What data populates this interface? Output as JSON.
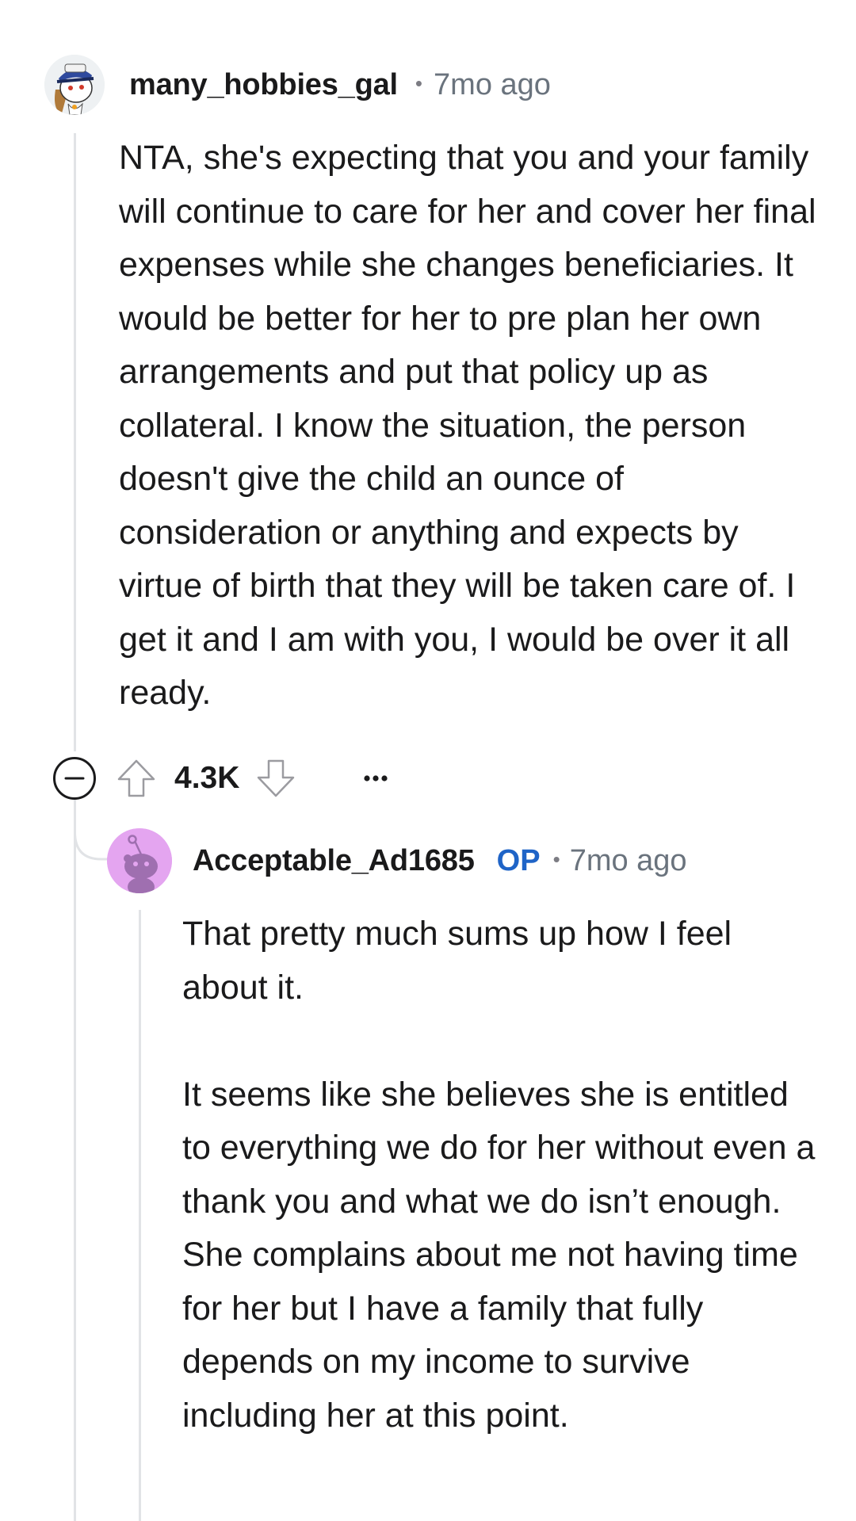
{
  "comments": [
    {
      "username": "many_hobbies_gal",
      "time": "7mo ago",
      "avatar_icon": "snoo-avatar-sailor",
      "text": "NTA, she's expecting that you and your family will continue to care for her and cover her final expenses while she changes beneficiaries. It would be better for her to pre plan her own arrangements and put that policy up as collateral. I know the situation, the person doesn't give the child an ounce of consideration or anything and expects by virtue of birth that they will be taken care of. I get it and I am with you, I would be over it all ready.",
      "actions": {
        "collapse_icon": "collapse-minus-icon",
        "upvote_icon": "upvote-arrow-icon",
        "vote_count": "4.3K",
        "downvote_icon": "downvote-arrow-icon",
        "more_icon": "more-options-icon"
      }
    },
    {
      "username": "Acceptable_Ad1685",
      "op_badge": "OP",
      "time": "7mo ago",
      "avatar_icon": "snoo-avatar-default",
      "paragraphs": [
        "That pretty much sums up how I feel about it.",
        "It seems like she believes she is entitled to everything we do for her without even a thank you and what we do isn’t enough. She complains about me not having time for her but I have a family that fully depends on my income to survive including her at this point."
      ]
    }
  ],
  "colors": {
    "text": "#1a1a1b",
    "meta": "#6a737d",
    "op": "#1f64c7",
    "thread_line": "#e1e3e6",
    "avatar_bg_2": "#e4a5f0"
  }
}
